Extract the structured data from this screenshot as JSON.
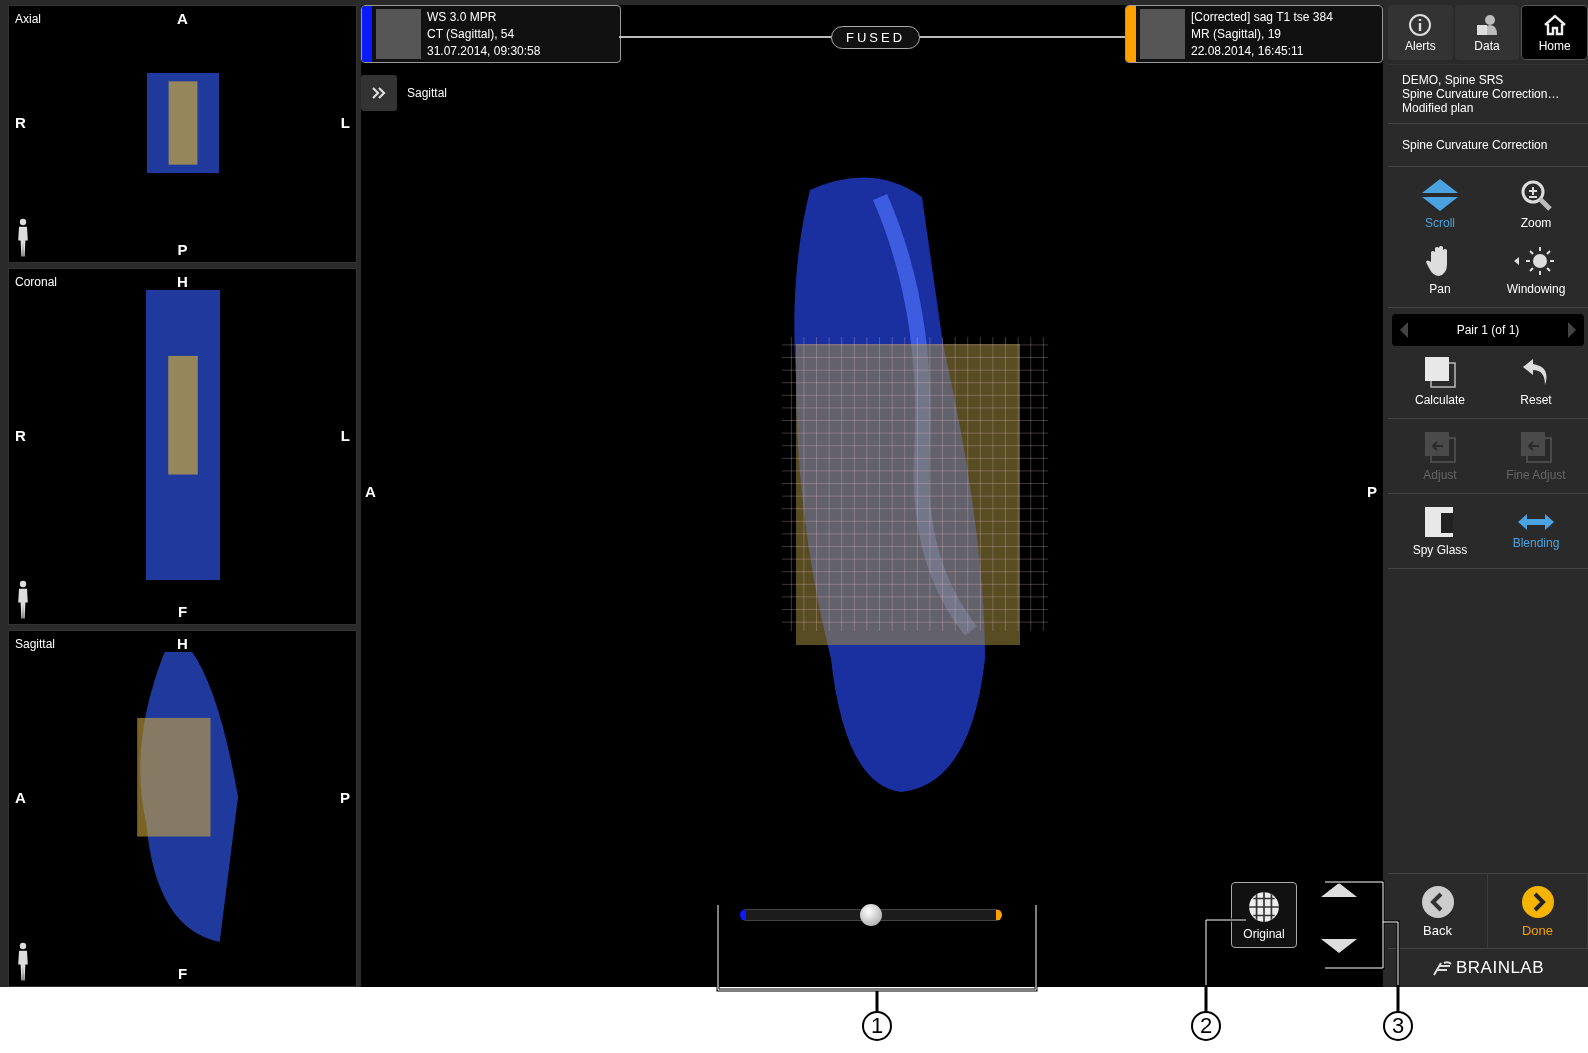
{
  "views": [
    {
      "name": "Axial",
      "top": "A",
      "bottom": "P",
      "left": "R",
      "right": "L"
    },
    {
      "name": "Coronal",
      "top": "H",
      "bottom": "F",
      "left": "R",
      "right": "L"
    },
    {
      "name": "Sagittal",
      "top": "H",
      "bottom": "F",
      "left": "A",
      "right": "P"
    }
  ],
  "main_view": {
    "name": "Sagittal",
    "left": "A",
    "right": "P"
  },
  "series": [
    {
      "title": "WS 3.0 MPR",
      "line_2": "CT (Sagittal), 54",
      "line_3": "31.07.2014, 09:30:58",
      "color": "#0a1cff"
    },
    {
      "title": "[Corrected] sag T1 tse 384",
      "line_2": "MR (Sagittal), 19",
      "line_3": "22.08.2014, 16:45:11",
      "color": "#ffa200"
    }
  ],
  "fused_label": "FUSED",
  "blend_slider": {
    "level": 0.5
  },
  "original_button": "Original",
  "top_nav": [
    {
      "label": "Alerts",
      "selected": false
    },
    {
      "label": "Data",
      "selected": false
    },
    {
      "label": "Home",
      "selected": true
    }
  ],
  "patient_info": [
    "DEMO, Spine SRS",
    "Spine Curvature Correction…",
    "Modified plan"
  ],
  "workflow_step": "Spine Curvature Correction",
  "tool_groups": [
    {
      "tools": [
        {
          "label": "Scroll",
          "selected": true,
          "disabled": false
        },
        {
          "label": "Zoom",
          "selected": false,
          "disabled": false
        },
        {
          "label": "Pan",
          "selected": false,
          "disabled": false
        },
        {
          "label": "Windowing",
          "selected": false,
          "disabled": false
        }
      ]
    },
    {
      "pair_selector": "Pair 1 (of 1)",
      "tools": [
        {
          "label": "Calculate",
          "selected": false,
          "disabled": false
        },
        {
          "label": "Reset",
          "selected": false,
          "disabled": false
        }
      ]
    },
    {
      "tools": [
        {
          "label": "Adjust",
          "selected": false,
          "disabled": true
        },
        {
          "label": "Fine Adjust",
          "selected": false,
          "disabled": true
        }
      ]
    },
    {
      "tools": [
        {
          "label": "Spy Glass",
          "selected": false,
          "disabled": false
        },
        {
          "label": "Blending",
          "selected": true,
          "disabled": false
        }
      ]
    }
  ],
  "footer": [
    {
      "label": "Back",
      "kind": "back"
    },
    {
      "label": "Done",
      "kind": "done"
    }
  ],
  "brand": "BRAINLAB",
  "callouts": [
    "1",
    "2",
    "3"
  ]
}
